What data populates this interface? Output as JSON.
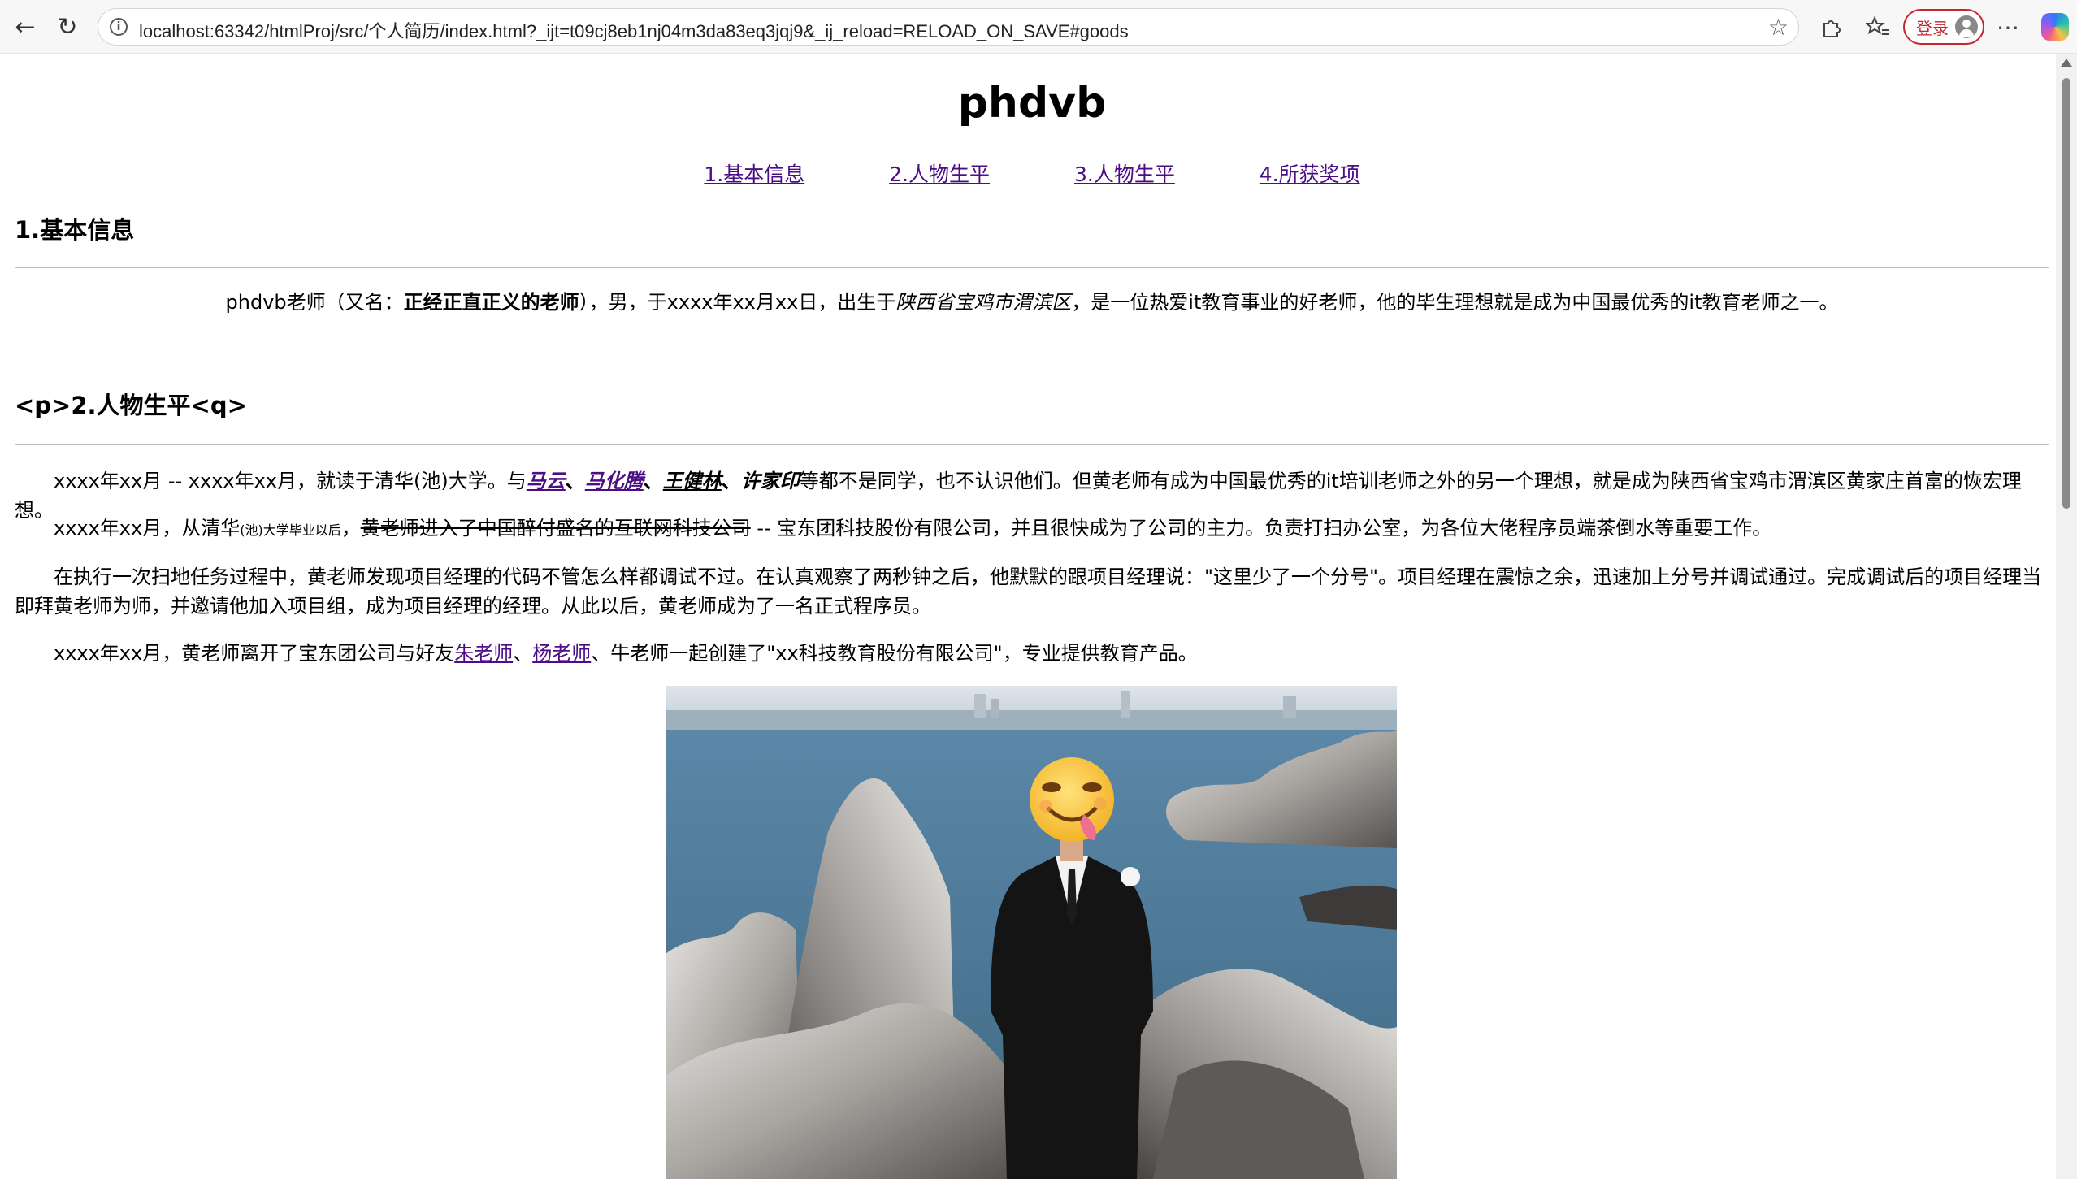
{
  "browser": {
    "url": "localhost:63342/htmlProj/src/个人简历/index.html?_ijt=t09cj8eb1nj04m3da83eq3jqj9&_ij_reload=RELOAD_ON_SAVE#goods",
    "login_label": "登录"
  },
  "page": {
    "title": "phdvb",
    "nav": [
      "1.基本信息",
      "2.人物生平",
      "3.人物生平",
      "4.所获奖项"
    ],
    "section1": {
      "heading": "1.基本信息",
      "intro_a": "phdvb老师（又名：",
      "intro_bold": "正经正直正义的老师",
      "intro_b": "），男，于xxxx年xx月xx日，出生于",
      "intro_italic": "陕西省宝鸡市渭滨区",
      "intro_c": "，是一位热爱it教育事业的好老师，他的毕生理想就是成为中国最优秀的it教育老师之一。"
    },
    "section2": {
      "heading": "<p>2.人物生平<q>",
      "p1_a": "xxxx年xx月 -- xxxx年xx月，就读于清华(池)大学。与",
      "p1_links": [
        "马云",
        "马化腾"
      ],
      "p1_sep": "、",
      "p1_bi": [
        "王健林",
        "许家印"
      ],
      "p1_b": "等都不是同学，也不认识他们。但黄老师有成为中国最优秀的it培训老师之外的另一个理想，就是成为陕西省宝鸡市渭滨区黄家庄首富的恢宏理想。",
      "p2_a": "xxxx年xx月，从清华",
      "p2_small": "(池)大学毕业以后",
      "p2_comma": "，",
      "p2_strike": "黄老师进入了中国醉付盛名的互联网科技公司",
      "p2_b": " -- 宝东团科技股份有限公司，并且很快成为了公司的主力。负责打扫办公室，为各位大佬程序员端茶倒水等重要工作。",
      "p3": "在执行一次扫地任务过程中，黄老师发现项目经理的代码不管怎么样都调试不过。在认真观察了两秒钟之后，他默默的跟项目经理说：\"这里少了一个分号\"。项目经理在震惊之余，迅速加上分号并调试通过。完成调试后的项目经理当即拜黄老师为师，并邀请他加入项目组，成为项目经理的经理。从此以后，黄老师成为了一名正式程序员。",
      "p4_a": "xxxx年xx月，黄老师离开了宝东团公司与好友",
      "p4_link1": "朱老师",
      "p4_sep": "、",
      "p4_link2": "杨老师",
      "p4_b": "、牛老师一起创建了\"xx科技教育股份有限公司\"，专业提供教育产品。"
    }
  }
}
